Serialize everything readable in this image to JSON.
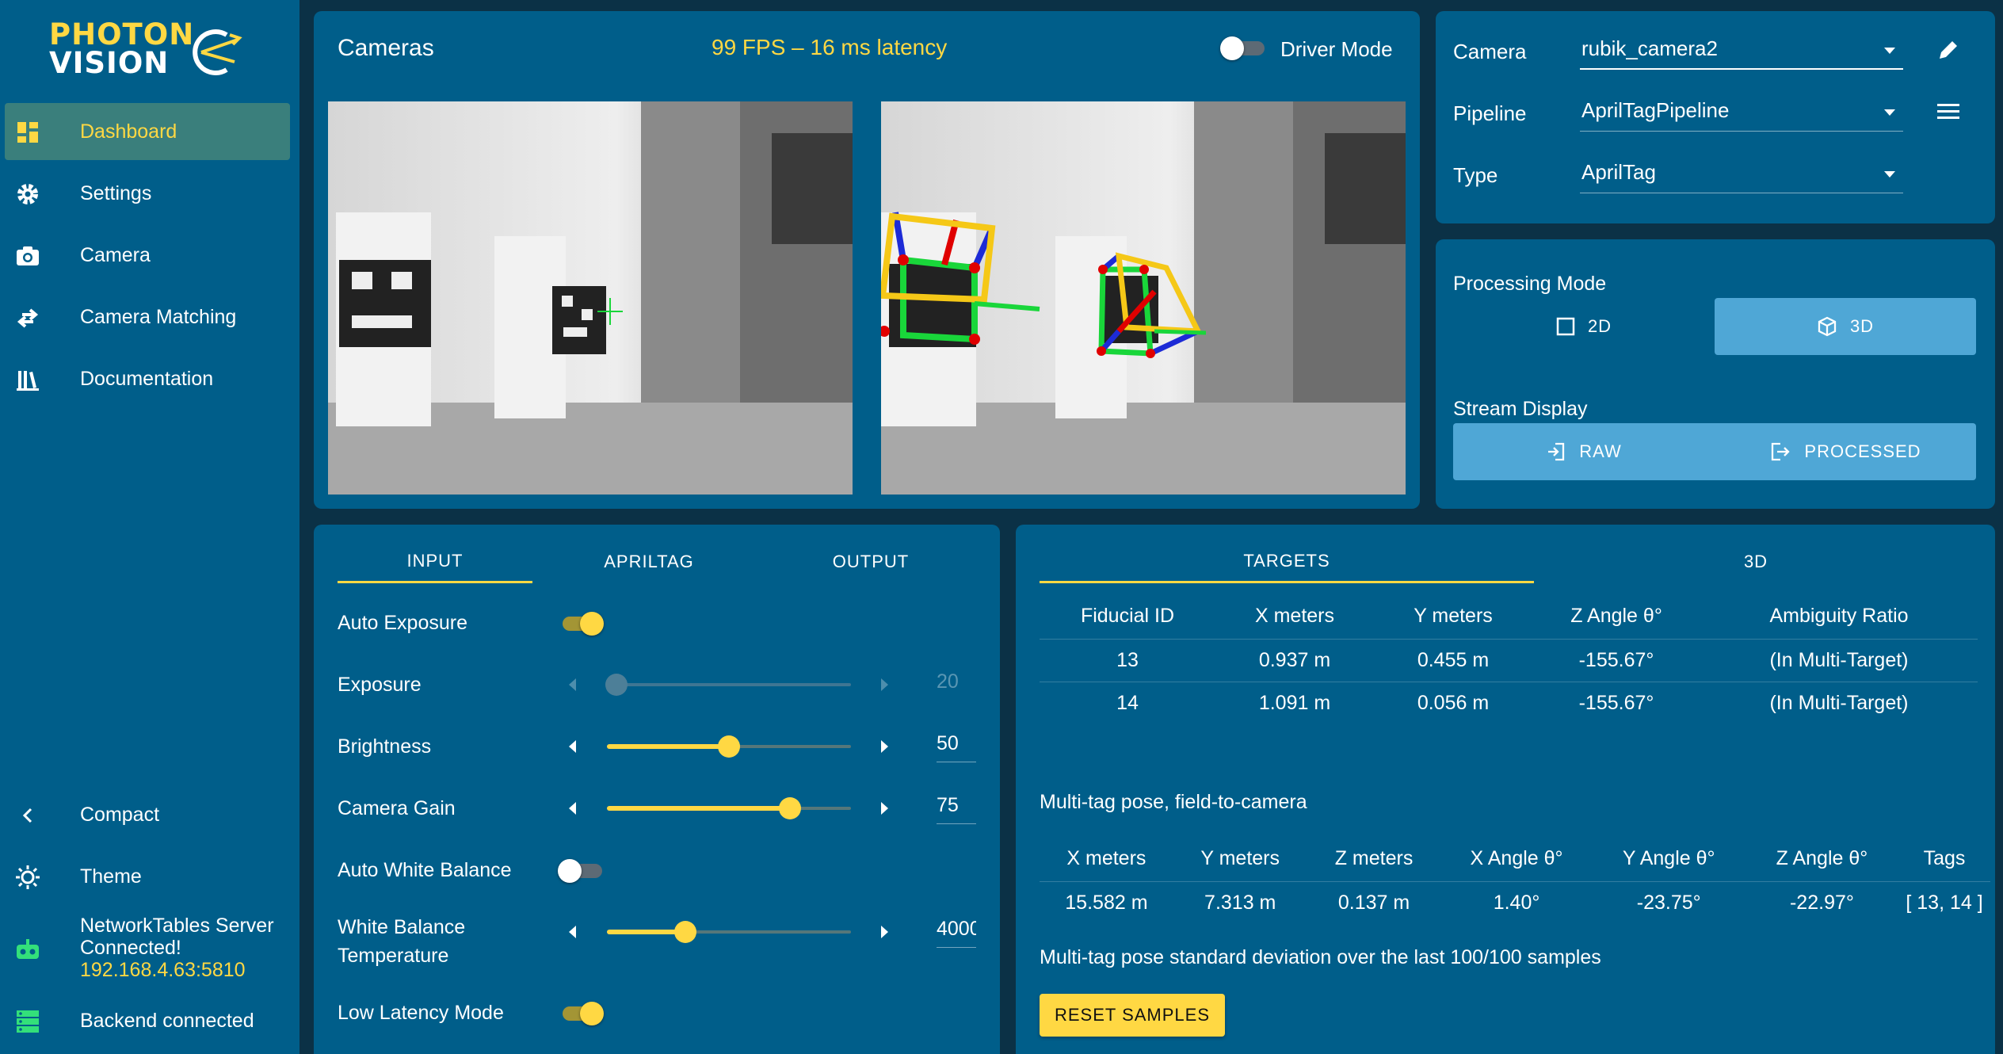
{
  "brand": {
    "line1": "PHOTON",
    "line2": "VISION"
  },
  "nav": {
    "items": [
      {
        "label": "Dashboard",
        "icon": "dashboard-icon",
        "active": true
      },
      {
        "label": "Settings",
        "icon": "gear-icon"
      },
      {
        "label": "Camera",
        "icon": "camera-icon"
      },
      {
        "label": "Camera Matching",
        "icon": "swap-icon"
      },
      {
        "label": "Documentation",
        "icon": "book-icon"
      }
    ],
    "compact": "Compact",
    "theme": "Theme",
    "nt_status": "NetworkTables Server",
    "nt_status2": "Connected!",
    "nt_address": "192.168.4.63:5810",
    "backend": "Backend connected"
  },
  "cameras": {
    "title": "Cameras",
    "fps": "99 FPS – 16 ms latency",
    "driver_mode_label": "Driver Mode",
    "driver_mode": false
  },
  "selectors": {
    "camera_label": "Camera",
    "camera_value": "rubik_camera2",
    "pipeline_label": "Pipeline",
    "pipeline_value": "AprilTagPipeline",
    "type_label": "Type",
    "type_value": "AprilTag"
  },
  "processing": {
    "mode_label": "Processing Mode",
    "mode_2d": "2D",
    "mode_3d": "3D",
    "selected": "3D",
    "stream_label": "Stream Display",
    "raw": "RAW",
    "processed": "PROCESSED"
  },
  "settings": {
    "tabs": [
      "INPUT",
      "APRILTAG",
      "OUTPUT"
    ],
    "auto_exposure_label": "Auto Exposure",
    "auto_exposure": true,
    "exposure_label": "Exposure",
    "exposure": "20",
    "exposure_fraction": 0.04,
    "brightness_label": "Brightness",
    "brightness": "50",
    "brightness_fraction": 0.5,
    "gain_label": "Camera Gain",
    "gain": "75",
    "gain_fraction": 0.75,
    "awb_label": "Auto White Balance",
    "awb": false,
    "wb_label_1": "White Balance",
    "wb_label_2": "Temperature",
    "wb": "4000",
    "wb_fraction": 0.32,
    "low_latency_label": "Low Latency Mode",
    "low_latency": true
  },
  "targets": {
    "tabs": [
      "TARGETS",
      "3D"
    ],
    "columns": [
      "Fiducial ID",
      "X meters",
      "Y meters",
      "Z Angle θ°",
      "Ambiguity Ratio"
    ],
    "rows": [
      [
        "13",
        "0.937 m",
        "0.455 m",
        "-155.67°",
        "(In Multi-Target)"
      ],
      [
        "14",
        "1.091 m",
        "0.056 m",
        "-155.67°",
        "(In Multi-Target)"
      ]
    ],
    "multitag_title": "Multi-tag pose, field-to-camera",
    "multitag_columns": [
      "X meters",
      "Y meters",
      "Z meters",
      "X Angle θ°",
      "Y Angle θ°",
      "Z Angle θ°",
      "Tags"
    ],
    "multitag_row": [
      "15.582 m",
      "7.313 m",
      "0.137 m",
      "1.40°",
      "-23.75°",
      "-22.97°",
      "[ 13, 14 ]"
    ],
    "stddev_label": "Multi-tag pose standard deviation over the last 100/100 samples",
    "reset_label": "RESET SAMPLES"
  },
  "colors": {
    "sidebar": "#005e8a",
    "accent": "#ffd843",
    "background": "#0b3146",
    "active_nav": "#3a7f7c",
    "button_blue": "#4fa7d6"
  }
}
